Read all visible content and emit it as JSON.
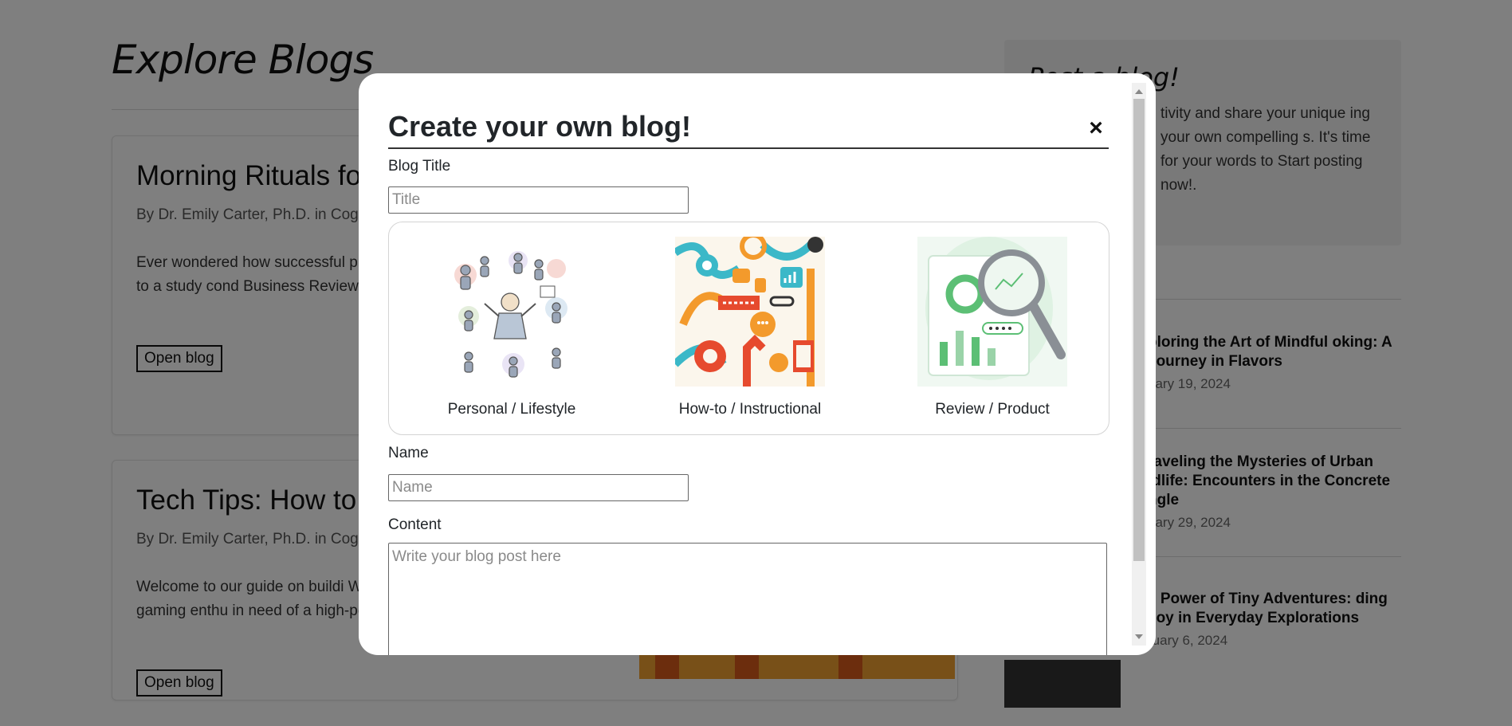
{
  "page": {
    "title": "Explore Blogs",
    "posts": [
      {
        "title": "Morning Rituals fo",
        "meta": "By Dr. Emily Carter, Ph.D. in Cog",
        "excerpt": "Ever wondered how successful p day? According to a study cond Business Review, incorporating r",
        "button": "Open blog"
      },
      {
        "title": "Tech Tips: How to",
        "meta": "By Dr. Emily Carter, Ph.D. in Cog",
        "excerpt": "Welcome to our guide on buildi Whether you're a gaming enthu in need of a high-performance v",
        "button": "Open blog"
      }
    ]
  },
  "sidebar": {
    "heading": "Post a blog!",
    "text": "tivity and share your unique ing your own compelling s. It's time for your words to Start posting now!.",
    "recent_posts": [
      {
        "title": "ploring the Art of Mindful oking: A Journey in Flavors",
        "date": "uary 19, 2024"
      },
      {
        "title": "raveling the Mysteries of Urban ldlife: Encounters in the Concrete ngle",
        "date": "uary 29, 2024"
      },
      {
        "title": "e Power of Tiny Adventures: ding Joy in Everyday Explorations",
        "date": "ruary 6, 2024"
      }
    ]
  },
  "modal": {
    "title": "Create your own blog!",
    "close_icon": "×",
    "blog_title_label": "Blog Title",
    "blog_title_placeholder": "Title",
    "blog_types": [
      {
        "label": "Personal / Lifestyle",
        "icon": "people-illustration"
      },
      {
        "label": "How-to / Instructional",
        "icon": "icons-pattern-illustration"
      },
      {
        "label": "Review / Product",
        "icon": "magnifier-chart-illustration"
      }
    ],
    "name_label": "Name",
    "name_placeholder": "Name",
    "content_label": "Content",
    "content_placeholder": "Write your blog post here"
  },
  "colors": {
    "overlay": "#808080",
    "accent_orange": "#f39a2c",
    "accent_teal": "#3bb8c8",
    "accent_green": "#5cbf75"
  }
}
